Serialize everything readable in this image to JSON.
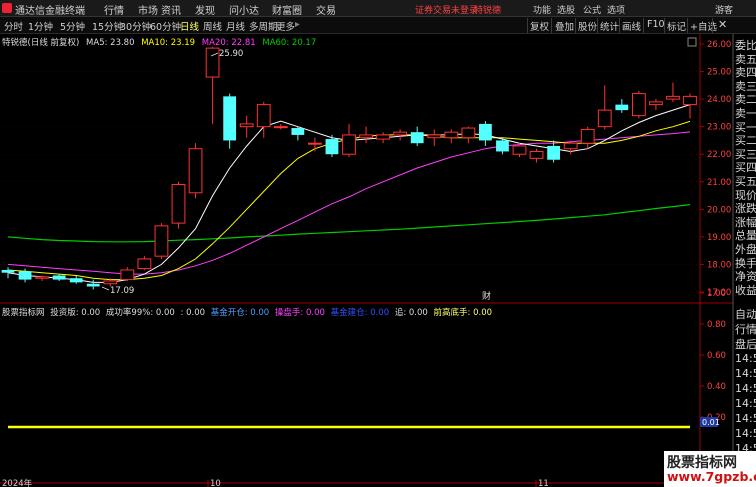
{
  "menubar": {
    "app_title": "通达信金融终端",
    "items": [
      "行情",
      "市场",
      "资讯",
      "发现",
      "问小达",
      "财富圈",
      "交易"
    ],
    "status": "证券交易未登录",
    "account": "特锐德",
    "right_items": [
      "功能",
      "选股",
      "公式",
      "选项"
    ],
    "guest": "游客"
  },
  "toolbar": {
    "timeframes": [
      "分时",
      "1分钟",
      "5分钟",
      "15分钟",
      "30分钟",
      "60分钟",
      "日线",
      "周线",
      "月线",
      "多周期",
      "更多"
    ],
    "active_timeframe": "日线",
    "right_buttons": [
      "复权",
      "叠加",
      "股份",
      "统计",
      "画线",
      "F10",
      "标记",
      "+自选"
    ]
  },
  "legend_main": {
    "title": "特锐德(日线 前复权)",
    "ma5": "MA5: 23.80",
    "ma10": "MA10: 23.19",
    "ma20": "MA20: 22.81",
    "ma60": "MA60: 20.17",
    "colors": {
      "ma5": "#ffffff",
      "ma10": "#ffff00",
      "ma20": "#ff40ff",
      "ma60": "#00cc00"
    }
  },
  "legend_sub": {
    "title": "股票指标网",
    "version": "投资版: 0.00",
    "winrate": "成功率99%: 0.00",
    "time": ": 0.00",
    "main_open": "基金开仓: 0.00",
    "trader": "操盘手: 0.00",
    "main_build": "基金建仓: 0.00",
    "chase": "追: 0.00",
    "bottom": "前高底手: 0.00"
  },
  "chart_data": {
    "type": "candlestick",
    "y_axis": {
      "min": 17,
      "max": 26,
      "ticks": [
        "26.00",
        "25.00",
        "24.00",
        "23.00",
        "22.00",
        "21.00",
        "20.00",
        "19.00",
        "18.00",
        "17.00"
      ]
    },
    "annotations": {
      "high": "25.90",
      "low": "17.09",
      "marker": "财"
    },
    "date_labels": [
      "2024年",
      "10",
      "11"
    ],
    "candles": [
      {
        "o": 17.8,
        "h": 17.9,
        "l": 17.5,
        "c": 17.7
      },
      {
        "o": 17.75,
        "h": 17.85,
        "l": 17.35,
        "c": 17.45
      },
      {
        "o": 17.5,
        "h": 17.6,
        "l": 17.4,
        "c": 17.55
      },
      {
        "o": 17.6,
        "h": 17.65,
        "l": 17.4,
        "c": 17.45
      },
      {
        "o": 17.5,
        "h": 17.6,
        "l": 17.3,
        "c": 17.35
      },
      {
        "o": 17.3,
        "h": 17.45,
        "l": 17.09,
        "c": 17.2
      },
      {
        "o": 17.3,
        "h": 17.5,
        "l": 17.2,
        "c": 17.4
      },
      {
        "o": 17.45,
        "h": 17.9,
        "l": 17.4,
        "c": 17.8
      },
      {
        "o": 17.85,
        "h": 18.3,
        "l": 17.8,
        "c": 18.2
      },
      {
        "o": 18.3,
        "h": 19.5,
        "l": 18.2,
        "c": 19.4
      },
      {
        "o": 19.5,
        "h": 21.0,
        "l": 19.3,
        "c": 20.9
      },
      {
        "o": 20.6,
        "h": 22.4,
        "l": 20.4,
        "c": 22.2
      },
      {
        "o": 24.8,
        "h": 25.9,
        "l": 23.1,
        "c": 25.85
      },
      {
        "o": 24.1,
        "h": 24.2,
        "l": 22.2,
        "c": 22.5
      },
      {
        "o": 23.0,
        "h": 23.4,
        "l": 22.6,
        "c": 23.1
      },
      {
        "o": 23.0,
        "h": 23.9,
        "l": 22.6,
        "c": 23.8
      },
      {
        "o": 23.0,
        "h": 23.1,
        "l": 22.9,
        "c": 23.0
      },
      {
        "o": 22.95,
        "h": 23.0,
        "l": 22.5,
        "c": 22.7
      },
      {
        "o": 22.4,
        "h": 22.6,
        "l": 22.1,
        "c": 22.4
      },
      {
        "o": 22.55,
        "h": 22.7,
        "l": 21.9,
        "c": 22.0
      },
      {
        "o": 22.0,
        "h": 23.1,
        "l": 21.9,
        "c": 22.7
      },
      {
        "o": 22.6,
        "h": 23.0,
        "l": 22.4,
        "c": 22.7
      },
      {
        "o": 22.55,
        "h": 22.8,
        "l": 22.4,
        "c": 22.7
      },
      {
        "o": 22.7,
        "h": 22.9,
        "l": 22.5,
        "c": 22.8
      },
      {
        "o": 22.8,
        "h": 23.0,
        "l": 22.3,
        "c": 22.4
      },
      {
        "o": 22.6,
        "h": 22.9,
        "l": 22.3,
        "c": 22.7
      },
      {
        "o": 22.6,
        "h": 22.9,
        "l": 22.4,
        "c": 22.8
      },
      {
        "o": 22.6,
        "h": 23.0,
        "l": 22.4,
        "c": 22.95
      },
      {
        "o": 23.1,
        "h": 23.2,
        "l": 22.3,
        "c": 22.5
      },
      {
        "o": 22.5,
        "h": 22.6,
        "l": 22.0,
        "c": 22.1
      },
      {
        "o": 22.0,
        "h": 22.4,
        "l": 21.9,
        "c": 22.3
      },
      {
        "o": 21.85,
        "h": 22.2,
        "l": 21.7,
        "c": 22.1
      },
      {
        "o": 22.3,
        "h": 22.5,
        "l": 21.7,
        "c": 21.8
      },
      {
        "o": 22.2,
        "h": 22.5,
        "l": 22.0,
        "c": 22.4
      },
      {
        "o": 22.4,
        "h": 23.0,
        "l": 22.2,
        "c": 22.9
      },
      {
        "o": 23.0,
        "h": 24.5,
        "l": 22.9,
        "c": 23.6
      },
      {
        "o": 23.8,
        "h": 24.0,
        "l": 23.5,
        "c": 23.6
      },
      {
        "o": 23.4,
        "h": 24.3,
        "l": 23.3,
        "c": 24.2
      },
      {
        "o": 23.8,
        "h": 24.0,
        "l": 23.6,
        "c": 23.9
      },
      {
        "o": 24.0,
        "h": 24.6,
        "l": 23.9,
        "c": 24.1
      },
      {
        "o": 23.8,
        "h": 24.2,
        "l": 23.3,
        "c": 24.1
      }
    ],
    "ma5": [
      17.7,
      17.6,
      17.55,
      17.5,
      17.45,
      17.35,
      17.35,
      17.45,
      17.65,
      18.0,
      18.6,
      19.3,
      20.5,
      21.5,
      22.3,
      23.0,
      23.2,
      23.0,
      22.8,
      22.6,
      22.5,
      22.55,
      22.6,
      22.65,
      22.7,
      22.7,
      22.7,
      22.75,
      22.7,
      22.55,
      22.4,
      22.3,
      22.2,
      22.1,
      22.2,
      22.5,
      22.85,
      23.15,
      23.4,
      23.6,
      23.8
    ],
    "ma10": [
      17.8,
      17.75,
      17.7,
      17.65,
      17.6,
      17.5,
      17.45,
      17.45,
      17.5,
      17.6,
      17.85,
      18.2,
      18.75,
      19.35,
      20.0,
      20.65,
      21.3,
      21.85,
      22.2,
      22.4,
      22.55,
      22.65,
      22.7,
      22.7,
      22.7,
      22.65,
      22.6,
      22.6,
      22.6,
      22.6,
      22.55,
      22.5,
      22.45,
      22.4,
      22.4,
      22.4,
      22.5,
      22.65,
      22.85,
      23.0,
      23.19
    ],
    "ma20": [
      18.0,
      17.95,
      17.9,
      17.85,
      17.8,
      17.75,
      17.7,
      17.65,
      17.65,
      17.7,
      17.8,
      17.95,
      18.15,
      18.4,
      18.7,
      19.0,
      19.3,
      19.6,
      19.9,
      20.2,
      20.45,
      20.75,
      21.0,
      21.25,
      21.5,
      21.7,
      21.9,
      22.05,
      22.2,
      22.3,
      22.35,
      22.4,
      22.4,
      22.45,
      22.5,
      22.55,
      22.6,
      22.65,
      22.7,
      22.75,
      22.81
    ],
    "ma60": [
      19.0,
      18.95,
      18.9,
      18.87,
      18.85,
      18.83,
      18.82,
      18.82,
      18.83,
      18.85,
      18.88,
      18.9,
      18.93,
      18.96,
      19.0,
      19.03,
      19.06,
      19.1,
      19.13,
      19.16,
      19.19,
      19.22,
      19.25,
      19.28,
      19.32,
      19.36,
      19.4,
      19.44,
      19.48,
      19.52,
      19.56,
      19.6,
      19.65,
      19.7,
      19.75,
      19.8,
      19.88,
      19.95,
      20.03,
      20.1,
      20.17
    ],
    "sub_axis": {
      "ticks": [
        "1.00",
        "0.80",
        "0.60",
        "0.40",
        "0.20"
      ],
      "value": "0.01"
    }
  },
  "side_panel": {
    "labels": [
      "委比",
      "卖五",
      "卖四",
      "卖三",
      "卖二",
      "卖一",
      "买一",
      "买二",
      "买三",
      "买四",
      "买五",
      "现价",
      "涨跌",
      "涨幅",
      "总量",
      "外盘",
      "换手",
      "净资",
      "收益"
    ],
    "labels_lower": [
      "自动",
      "行情",
      "盘后"
    ],
    "times": [
      "14:50",
      "14:50",
      "14:50",
      "14:50",
      "14:50",
      "14:50",
      "14:50",
      "14:50"
    ]
  },
  "watermark": {
    "line1": "股票指标网",
    "line2": "www.7gpzb.com"
  }
}
